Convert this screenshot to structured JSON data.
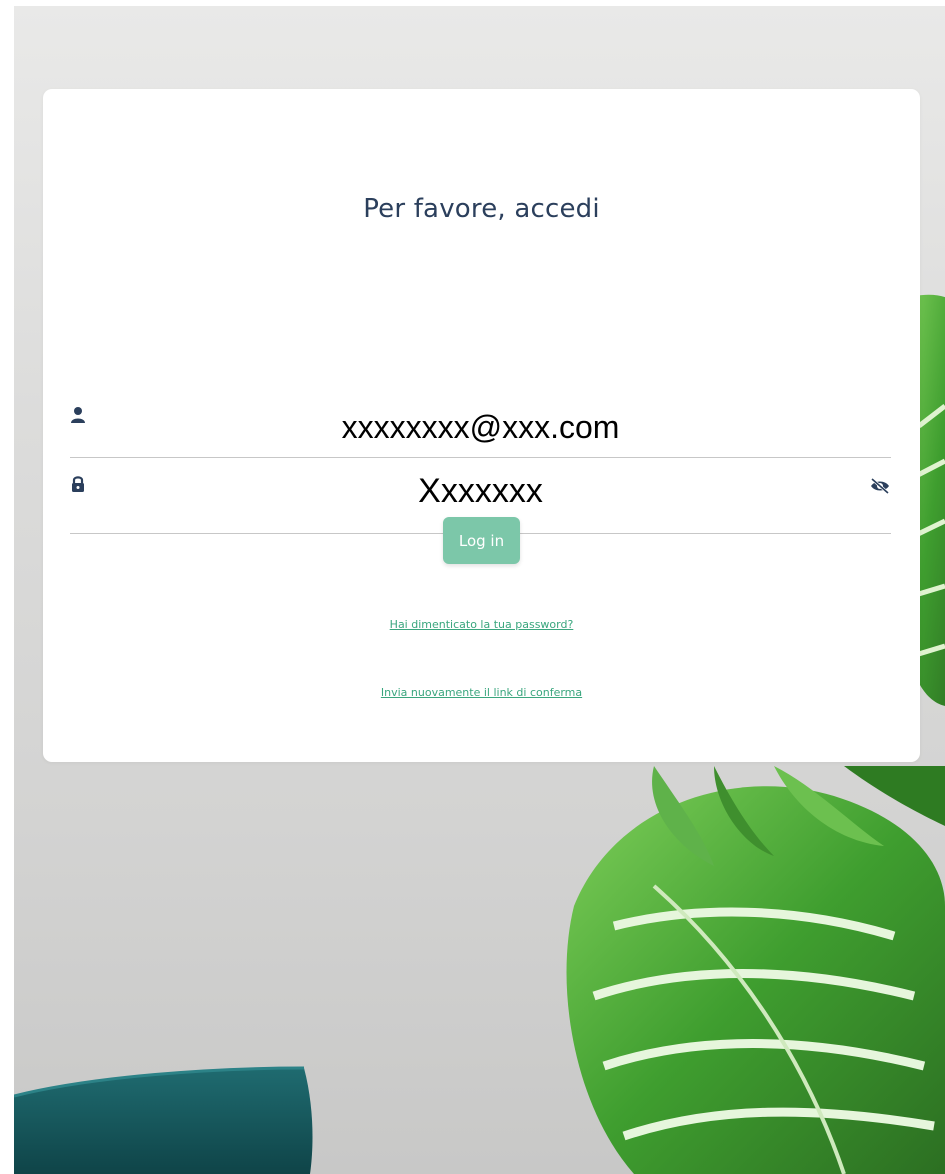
{
  "colors": {
    "title": "#2b3f5c",
    "accent": "#7cc7a9",
    "link": "#3aa67e",
    "field_icon": "#2b3f5c",
    "divider": "#c7c7c7"
  },
  "login": {
    "title": "Per favore, accedi",
    "username": {
      "icon": "user-icon",
      "value": "xxxxxxxx@xxx.com"
    },
    "password": {
      "icon": "lock-icon",
      "value": "Xxxxxxx",
      "toggle_icon": "eye-slash-icon"
    },
    "submit_label": "Log in",
    "forgot_password_link": "Hai dimenticato la tua password?",
    "resend_confirmation_link": "Invia nuovamente il link di conferma"
  }
}
